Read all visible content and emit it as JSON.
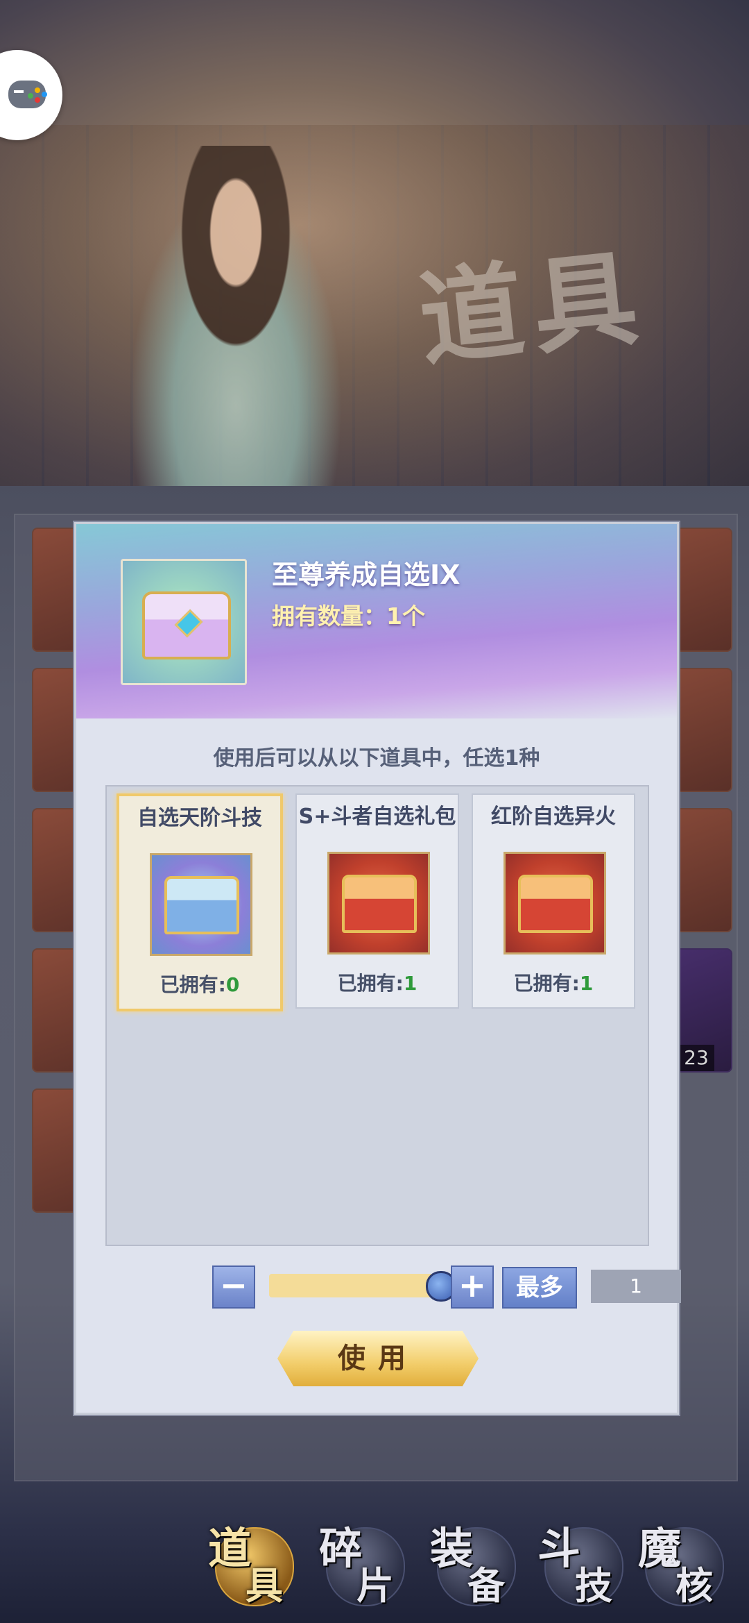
{
  "background": {
    "title_calligraphy": "道具",
    "slot_count_badge": "23"
  },
  "dialog": {
    "item_name": "至尊养成自选IX",
    "item_count": "拥有数量：1个",
    "instruction": "使用后可以从以下道具中，任选1种",
    "options": [
      {
        "label": "自选天阶斗技",
        "owned_label": "已拥有:",
        "owned_value": "0",
        "selected": true
      },
      {
        "label": "S+斗者自选礼包",
        "owned_label": "已拥有:",
        "owned_value": "1",
        "selected": false
      },
      {
        "label": "红阶自选异火",
        "owned_label": "已拥有:",
        "owned_value": "1",
        "selected": false
      }
    ],
    "quantity": {
      "minus_label": "−",
      "plus_label": "+",
      "max_label": "最多",
      "value": "1",
      "slider_fraction": 1.0
    },
    "use_button_label": "使用"
  },
  "bottom_nav": {
    "tabs": [
      {
        "char1": "道",
        "char2": "具",
        "active": true
      },
      {
        "char1": "碎",
        "char2": "片",
        "active": false
      },
      {
        "char1": "装",
        "char2": "备",
        "active": false
      },
      {
        "char1": "斗",
        "char2": "技",
        "active": false
      },
      {
        "char1": "魔",
        "char2": "核",
        "active": false
      }
    ]
  },
  "colors": {
    "owned_number": "#2f9a3b",
    "gold_accent": "#f0c96a",
    "button_blue": "#6b83c9"
  }
}
